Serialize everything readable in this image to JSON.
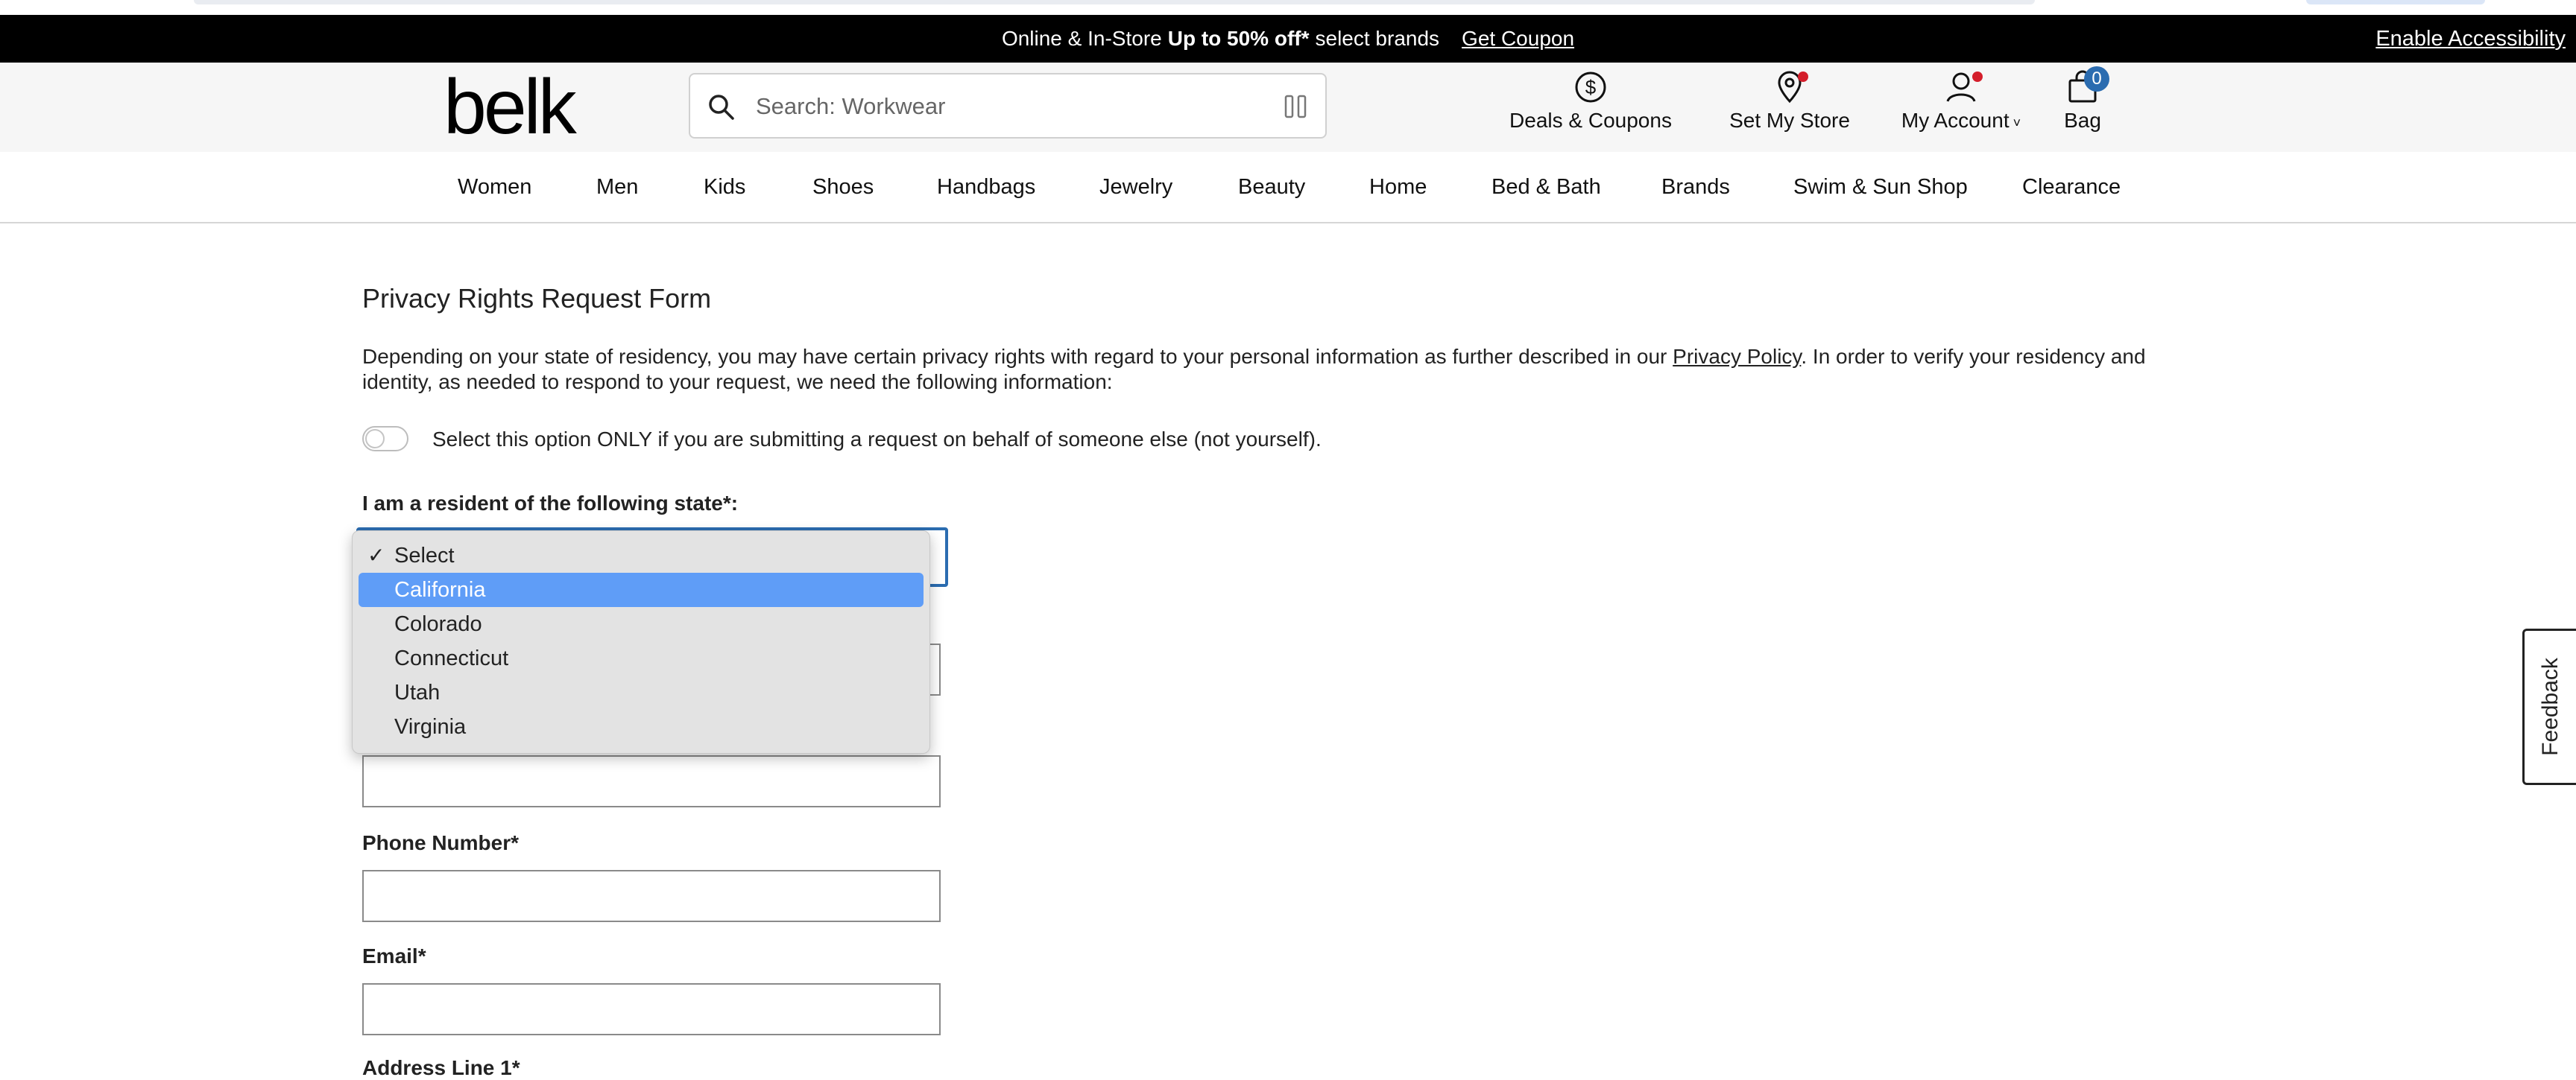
{
  "promo": {
    "lead": "Online & In-Store",
    "highlight": "Up to 50% off*",
    "tail": "select brands",
    "coupon_link": "Get Coupon",
    "accessibility": "Enable Accessibility"
  },
  "header": {
    "logo": "belk",
    "search_placeholder": "Search: Workwear",
    "actions": {
      "deals": "Deals & Coupons",
      "store": "Set My Store",
      "account": "My Account",
      "bag": "Bag",
      "bag_count": "0"
    }
  },
  "nav": {
    "items": [
      "Women",
      "Men",
      "Kids",
      "Shoes",
      "Handbags",
      "Jewelry",
      "Beauty",
      "Home",
      "Bed & Bath",
      "Brands",
      "Swim & Sun Shop",
      "Clearance"
    ]
  },
  "form": {
    "title": "Privacy Rights Request Form",
    "intro_part1": "Depending on your state of residency, you may have certain privacy rights with regard to your personal information as further described in our ",
    "intro_link": "Privacy Policy",
    "intro_part2": ". In order to verify your residency and identity, as needed to respond to your request, we need the following information:",
    "toggle_label": "Select this option ONLY if you are submitting a request on behalf of someone else (not yourself).",
    "state_label": "I am a resident of the following state*:",
    "phone_label": "Phone Number*",
    "email_label": "Email*",
    "address_label": "Address Line 1*"
  },
  "state_dropdown": {
    "current": "Select",
    "highlighted": "California",
    "options": [
      "Select",
      "California",
      "Colorado",
      "Connecticut",
      "Utah",
      "Virginia"
    ]
  },
  "feedback": "Feedback",
  "colors": {
    "promo_bg": "#000000",
    "header_bg": "#f6f6f6",
    "accent_blue": "#2b6cb0",
    "dropdown_highlight": "#5f9df7",
    "badge_red": "#d41e2b"
  }
}
